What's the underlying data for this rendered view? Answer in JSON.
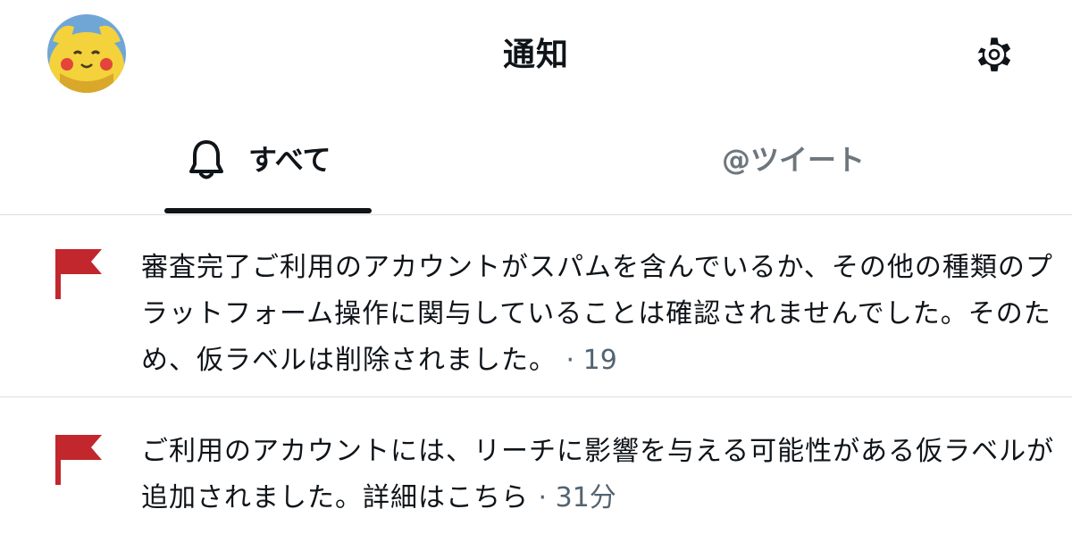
{
  "header": {
    "title": "通知",
    "avatar_icon": "pikachu-avatar-icon",
    "settings_icon": "gear-icon"
  },
  "tabs": [
    {
      "label": "すべて",
      "icon": "bell-icon",
      "active": true
    },
    {
      "label": "@ツイート",
      "active": false
    }
  ],
  "notifications": [
    {
      "icon": "flag-icon",
      "text": "審査完了ご利用のアカウントがスパムを含んでいるか、その他の種類のプラットフォーム操作に関与していることは確認されませんでした。そのため、仮ラベルは削除されました。",
      "time": "· 19"
    },
    {
      "icon": "flag-icon",
      "text": "ご利用のアカウントには、リーチに影響を与える可能性がある仮ラベルが追加されました。詳細はこちら",
      "time": "· 31分"
    }
  ],
  "colors": {
    "flag": "#c1272d",
    "text": "#0f1419",
    "muted": "#536471",
    "divider": "#dcdfe2"
  }
}
